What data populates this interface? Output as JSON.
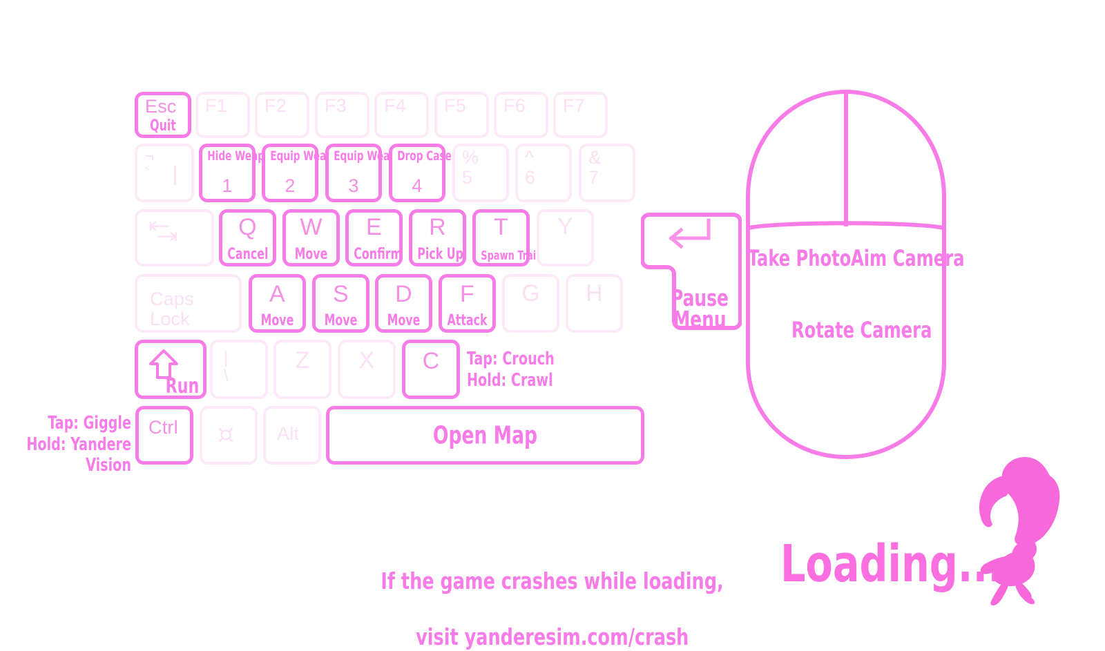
{
  "theme": {
    "background": "#ffffff",
    "accent_pink": "#f87ce8",
    "bright_pink": "#fb6fe0",
    "faint_pink": "#fdeaf8",
    "glyph_pink": "#fce0f6"
  },
  "keyboard": {
    "rows": [
      {
        "name": "function-row",
        "keys": [
          {
            "id": "esc",
            "glyph": "Esc",
            "action": "Quit",
            "state": "active"
          },
          {
            "id": "f1",
            "glyph": "F1",
            "action": "",
            "state": "inactive"
          },
          {
            "id": "f2",
            "glyph": "F2",
            "action": "",
            "state": "inactive"
          },
          {
            "id": "f3",
            "glyph": "F3",
            "action": "",
            "state": "inactive"
          },
          {
            "id": "f4",
            "glyph": "F4",
            "action": "",
            "state": "inactive"
          },
          {
            "id": "f5",
            "glyph": "F5",
            "action": "",
            "state": "inactive"
          },
          {
            "id": "f6",
            "glyph": "F6",
            "action": "",
            "state": "inactive"
          },
          {
            "id": "f7",
            "glyph": "F7",
            "action": "",
            "state": "inactive"
          }
        ]
      },
      {
        "name": "number-row",
        "keys": [
          {
            "id": "backtick",
            "glyph": "¬\n`",
            "action": "",
            "state": "inactive"
          },
          {
            "id": "digit1",
            "glyph": "1",
            "action": "Hide Weapon",
            "state": "active"
          },
          {
            "id": "digit2",
            "glyph": "2",
            "action": "Equip Weapon",
            "state": "active"
          },
          {
            "id": "digit3",
            "glyph": "3",
            "action": "Equip Weapon",
            "state": "active"
          },
          {
            "id": "digit4",
            "glyph": "4",
            "action": "Drop Case",
            "state": "active"
          },
          {
            "id": "digit5",
            "glyph": "%\n5",
            "action": "",
            "state": "inactive"
          },
          {
            "id": "digit6",
            "glyph": "^\n6",
            "action": "",
            "state": "inactive"
          },
          {
            "id": "digit7",
            "glyph": "&\n7",
            "action": "",
            "state": "inactive"
          }
        ]
      },
      {
        "name": "qwerty-row",
        "keys": [
          {
            "id": "tab",
            "glyph": "",
            "action": "",
            "state": "inactive"
          },
          {
            "id": "q",
            "glyph": "Q",
            "action": "Cancel",
            "state": "active"
          },
          {
            "id": "w",
            "glyph": "W",
            "action": "Move",
            "state": "active"
          },
          {
            "id": "e",
            "glyph": "E",
            "action": "Confirm",
            "state": "active"
          },
          {
            "id": "r",
            "glyph": "R",
            "action": "Pick Up",
            "state": "active"
          },
          {
            "id": "t",
            "glyph": "T",
            "action": "Spawn Trail",
            "state": "active"
          },
          {
            "id": "y",
            "glyph": "Y",
            "action": "",
            "state": "inactive"
          }
        ]
      },
      {
        "name": "home-row",
        "keys": [
          {
            "id": "capslock",
            "glyph": "Caps\nLock",
            "action": "",
            "state": "inactive"
          },
          {
            "id": "a",
            "glyph": "A",
            "action": "Move",
            "state": "active"
          },
          {
            "id": "s",
            "glyph": "S",
            "action": "Move",
            "state": "active"
          },
          {
            "id": "d",
            "glyph": "D",
            "action": "Move",
            "state": "active"
          },
          {
            "id": "f",
            "glyph": "F",
            "action": "Attack",
            "state": "active"
          },
          {
            "id": "g",
            "glyph": "G",
            "action": "",
            "state": "inactive"
          },
          {
            "id": "h",
            "glyph": "H",
            "action": "",
            "state": "inactive"
          }
        ]
      },
      {
        "name": "shift-row",
        "keys": [
          {
            "id": "shift",
            "glyph": "",
            "action": "Run",
            "state": "active"
          },
          {
            "id": "backslash",
            "glyph": "|\n\\",
            "action": "",
            "state": "inactive"
          },
          {
            "id": "z",
            "glyph": "Z",
            "action": "",
            "state": "inactive"
          },
          {
            "id": "x",
            "glyph": "X",
            "action": "",
            "state": "inactive"
          },
          {
            "id": "c",
            "glyph": "C",
            "action": "",
            "state": "active"
          }
        ]
      },
      {
        "name": "bottom-row",
        "keys": [
          {
            "id": "ctrl",
            "glyph": "Ctrl",
            "action": "",
            "state": "semi"
          },
          {
            "id": "win",
            "glyph": "",
            "action": "",
            "state": "inactive"
          },
          {
            "id": "alt",
            "glyph": "Alt",
            "action": "",
            "state": "inactive"
          },
          {
            "id": "space",
            "glyph": "",
            "action": "Open Map",
            "state": "active"
          }
        ]
      }
    ],
    "enter_key": {
      "action": "Pause\nMenu",
      "state": "active"
    }
  },
  "side_labels": {
    "c_key": "Tap: Crouch\nHold: Crawl",
    "ctrl_key": "Tap: Giggle\nHold: Yandere Vision"
  },
  "mouse": {
    "left_button": "Take Photo",
    "right_button": "Aim Camera",
    "body": "Rotate Camera"
  },
  "footer": {
    "crash_note_line1": "If the game crashes while loading,",
    "crash_note_line2": "visit yanderesim.com/crash",
    "loading_text": "Loading..."
  }
}
